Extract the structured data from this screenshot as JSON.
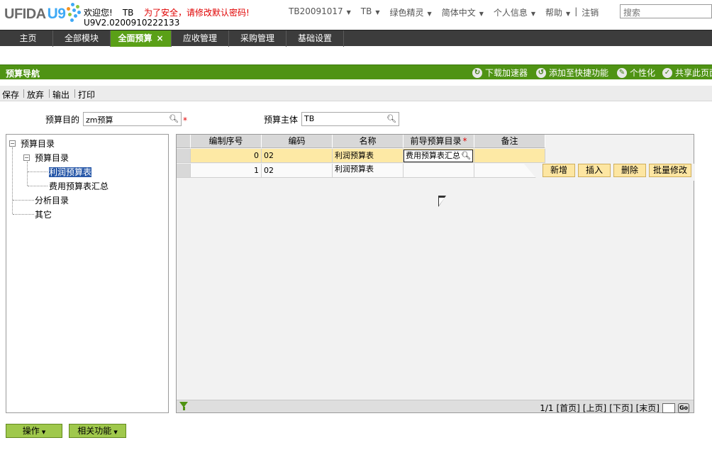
{
  "header": {
    "logo_text": "UFIDA",
    "logo_u9": "U9",
    "welcome": "欢迎您!",
    "user": "TB",
    "warning": "为了安全，请修改默认密码!",
    "version": "U9V2.0200910222133",
    "top_menu": [
      {
        "label": "TB20091017",
        "arrow": "▼"
      },
      {
        "label": "TB",
        "arrow": "▼"
      },
      {
        "label": "绿色精灵",
        "arrow": "▼"
      },
      {
        "label": "简体中文",
        "arrow": "▼"
      },
      {
        "label": "个人信息",
        "arrow": "▼"
      },
      {
        "label": "帮助",
        "arrow": "▼"
      }
    ],
    "menu_separator": "|",
    "logout": "注销",
    "search_placeholder": "搜索"
  },
  "nav": {
    "tabs": [
      {
        "label": "主页"
      },
      {
        "label": "全部模块"
      },
      {
        "label": "全面预算",
        "close": "×"
      },
      {
        "label": "应收管理"
      },
      {
        "label": "采购管理"
      },
      {
        "label": "基础设置"
      }
    ]
  },
  "greenbar": {
    "title": "预算导航",
    "tools": [
      {
        "label": "下载加速器",
        "icon": "download-icon"
      },
      {
        "label": "添加至快捷功能",
        "icon": "shortcut-icon"
      },
      {
        "label": "个性化",
        "icon": "personalize-icon"
      },
      {
        "label": "共享此页面",
        "icon": "share-icon"
      }
    ]
  },
  "toolbar": {
    "save": "保存",
    "discard": "放弃",
    "export": "输出",
    "print": "打印"
  },
  "form": {
    "purpose_label": "预算目的",
    "purpose_value": "zm预算",
    "subject_label": "预算主体",
    "subject_value": "TB",
    "required": "*"
  },
  "tree": {
    "root": "预算目录",
    "child": "预算目录",
    "leaf1": "利润预算表",
    "leaf2": "费用预算表汇总",
    "analysis": "分析目录",
    "other": "其它"
  },
  "grid": {
    "columns": [
      "编制序号",
      "编码",
      "名称",
      "前导预算目录",
      "备注"
    ],
    "required_mark": "*",
    "rows": [
      {
        "seq": "0",
        "code": "02",
        "name": "利润预算表",
        "prev": "费用预算表汇总",
        "remark": ""
      },
      {
        "seq": "1",
        "code": "02",
        "name": "利润预算表",
        "prev": "",
        "remark": ""
      }
    ],
    "row_buttons": [
      "新增",
      "插入",
      "删除",
      "批量修改"
    ],
    "pager": {
      "page_info": "1/1",
      "first": "[首页]",
      "prev": "[上页]",
      "next": "[下页]",
      "last": "[末页]",
      "go": "Go"
    }
  },
  "bottom": {
    "operate": "操作",
    "related": "相关功能",
    "arrow": "▼"
  },
  "colors": {
    "nav_bg": "#3c3c3c",
    "nav_active": "#5aa017",
    "greenbar": "#4f9314",
    "selected_row": "#fde9a5",
    "warning": "#e00000"
  }
}
